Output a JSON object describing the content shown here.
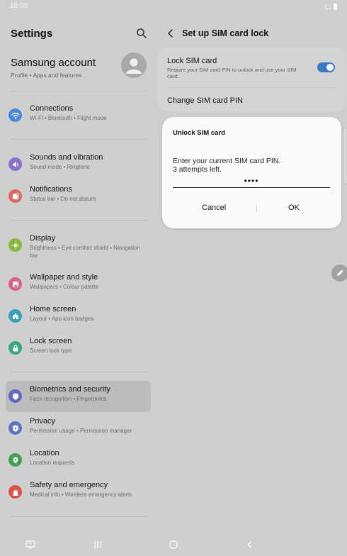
{
  "status": {
    "time": "10:00"
  },
  "settings": {
    "title": "Settings",
    "account": {
      "title": "Samsung account",
      "subtitle": "Profile  •  Apps and features"
    },
    "items": [
      {
        "title": "Connections",
        "subtitle": "Wi-Fi  •  Bluetooth  •  Flight mode",
        "icon": "wifi-icon",
        "color": "#4a88d8"
      },
      {
        "title": "Sounds and vibration",
        "subtitle": "Sound mode  •  Ringtone",
        "icon": "volume-icon",
        "color": "#8a6fd3"
      },
      {
        "title": "Notifications",
        "subtitle": "Status bar  •  Do not disturb",
        "icon": "bell-icon",
        "color": "#e0665f"
      },
      {
        "title": "Display",
        "subtitle": "Brightness  •  Eye comfort shield  •  Navigation bar",
        "icon": "sun-icon",
        "color": "#86b83a"
      },
      {
        "title": "Wallpaper and style",
        "subtitle": "Wallpapers  •  Colour palette",
        "icon": "image-icon",
        "color": "#dc5f86"
      },
      {
        "title": "Home screen",
        "subtitle": "Layout  •  App icon badges",
        "icon": "home-icon",
        "color": "#3a9fb9"
      },
      {
        "title": "Lock screen",
        "subtitle": "Screen lock type",
        "icon": "lock-icon",
        "color": "#3aa87f"
      },
      {
        "title": "Biometrics and security",
        "subtitle": "Face recognition  •  Fingerprints",
        "icon": "shield-icon",
        "color": "#6267c8"
      },
      {
        "title": "Privacy",
        "subtitle": "Permission usage  •  Permission manager",
        "icon": "privacy-icon",
        "color": "#5b72c9"
      },
      {
        "title": "Location",
        "subtitle": "Location requests",
        "icon": "location-pin-icon",
        "color": "#43a050"
      },
      {
        "title": "Safety and emergency",
        "subtitle": "Medical info  •  Wireless emergency alerts",
        "icon": "emergency-icon",
        "color": "#d8524a"
      }
    ]
  },
  "detail": {
    "title": "Set up SIM card lock",
    "lock": {
      "title": "Lock SIM card",
      "subtitle": "Require your SIM card PIN to unlock and use your SIM card.",
      "enabled": true
    },
    "change_pin": "Change SIM card PIN"
  },
  "dialog": {
    "title": "Unlock SIM card",
    "message_line1": "Enter your current SIM card PIN.",
    "message_line2": "3 attempts left.",
    "pin_value": "••••",
    "cancel": "Cancel",
    "ok": "OK"
  },
  "colors": {
    "accent": "#3c78c6",
    "background": "#cfcfcf",
    "dialog": "#fafafa"
  }
}
